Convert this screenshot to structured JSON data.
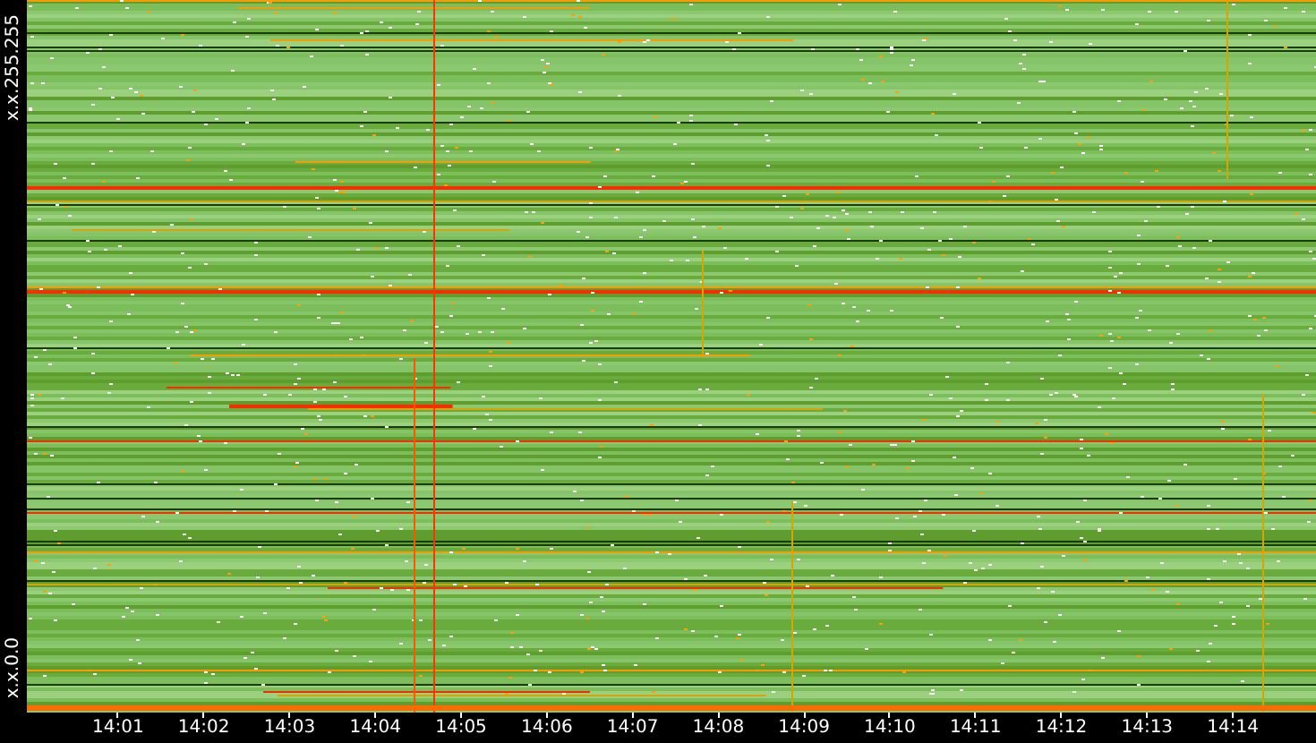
{
  "y_axis": {
    "top_label": "x.x.255.255",
    "bottom_label": "x.x.0.0"
  },
  "x_axis": {
    "ticks": [
      "14:01",
      "14:02",
      "14:03",
      "14:04",
      "14:05",
      "14:06",
      "14:07",
      "14:08",
      "14:09",
      "14:10",
      "14:11",
      "14:12",
      "14:13",
      "14:14"
    ]
  }
}
